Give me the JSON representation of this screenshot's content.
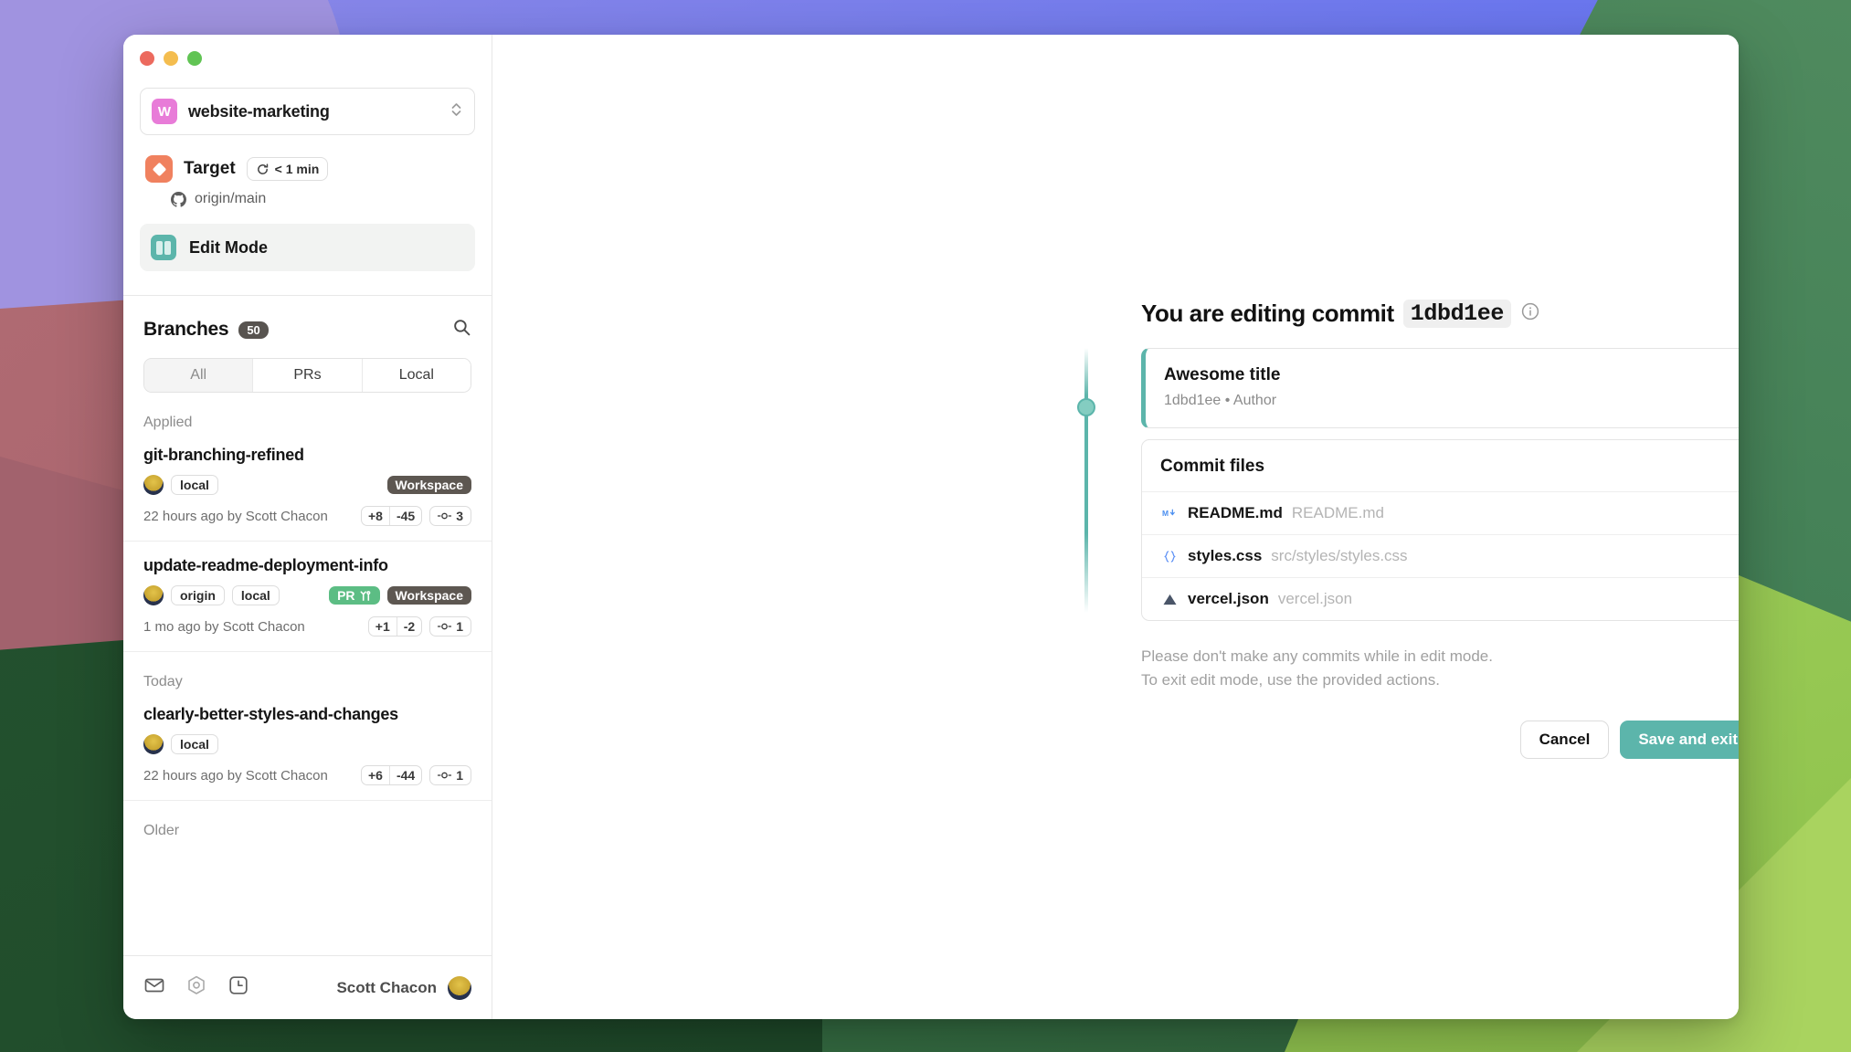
{
  "window": {
    "traffic_lights": [
      "close",
      "minimize",
      "zoom"
    ]
  },
  "sidebar": {
    "repo": {
      "initial": "W",
      "name": "website-marketing"
    },
    "target": {
      "label": "Target",
      "time_pill": "< 1 min",
      "remote": "origin/main"
    },
    "edit_mode": {
      "label": "Edit Mode"
    },
    "branches": {
      "title": "Branches",
      "count": "50",
      "tabs": [
        {
          "label": "All",
          "active": true
        },
        {
          "label": "PRs",
          "active": false
        },
        {
          "label": "Local",
          "active": false
        }
      ],
      "groups": [
        {
          "label": "Applied",
          "items": [
            {
              "name": "git-branching-refined",
              "tags": [
                "local"
              ],
              "pr": null,
              "workspace": "Workspace",
              "meta": "22 hours ago by Scott Chacon",
              "additions": "+8",
              "deletions": "-45",
              "commits": "3"
            },
            {
              "name": "update-readme-deployment-info",
              "tags": [
                "origin",
                "local"
              ],
              "pr": "PR",
              "workspace": "Workspace",
              "meta": "1 mo ago by Scott Chacon",
              "additions": "+1",
              "deletions": "-2",
              "commits": "1"
            }
          ]
        },
        {
          "label": "Today",
          "items": [
            {
              "name": "clearly-better-styles-and-changes",
              "tags": [
                "local"
              ],
              "pr": null,
              "workspace": null,
              "meta": "22 hours ago by Scott Chacon",
              "additions": "+6",
              "deletions": "-44",
              "commits": "1"
            }
          ]
        },
        {
          "label": "Older",
          "items": []
        }
      ]
    },
    "footer": {
      "icons": [
        "mail-icon",
        "settings-icon",
        "history-icon"
      ],
      "user": "Scott Chacon"
    }
  },
  "main": {
    "heading_prefix": "You are editing commit",
    "heading_hash": "1dbd1ee",
    "commit": {
      "title": "Awesome title",
      "subtitle": "1dbd1ee • Author"
    },
    "files": {
      "header": "Commit files",
      "items": [
        {
          "icon": "markdown-icon",
          "name": "README.md",
          "path": "README.md",
          "dot": false
        },
        {
          "icon": "css-braces-icon",
          "name": "styles.css",
          "path": "src/styles/styles.css",
          "dot": false
        },
        {
          "icon": "vercel-triangle-icon",
          "name": "vercel.json",
          "path": "vercel.json",
          "dot": true
        }
      ]
    },
    "notice_line1": "Please don't make any commits while in edit mode.",
    "notice_line2": "To exit edit mode, use the provided actions.",
    "buttons": {
      "cancel": "Cancel",
      "save": "Save and exit"
    }
  },
  "colors": {
    "accent_teal": "#5cb5ab",
    "target_orange": "#f0815f",
    "repo_pink": "#e87cd8",
    "pr_green": "#5cbd84",
    "workspace_gray": "#5d5751",
    "status_dot_green": "#8bd2a0"
  }
}
